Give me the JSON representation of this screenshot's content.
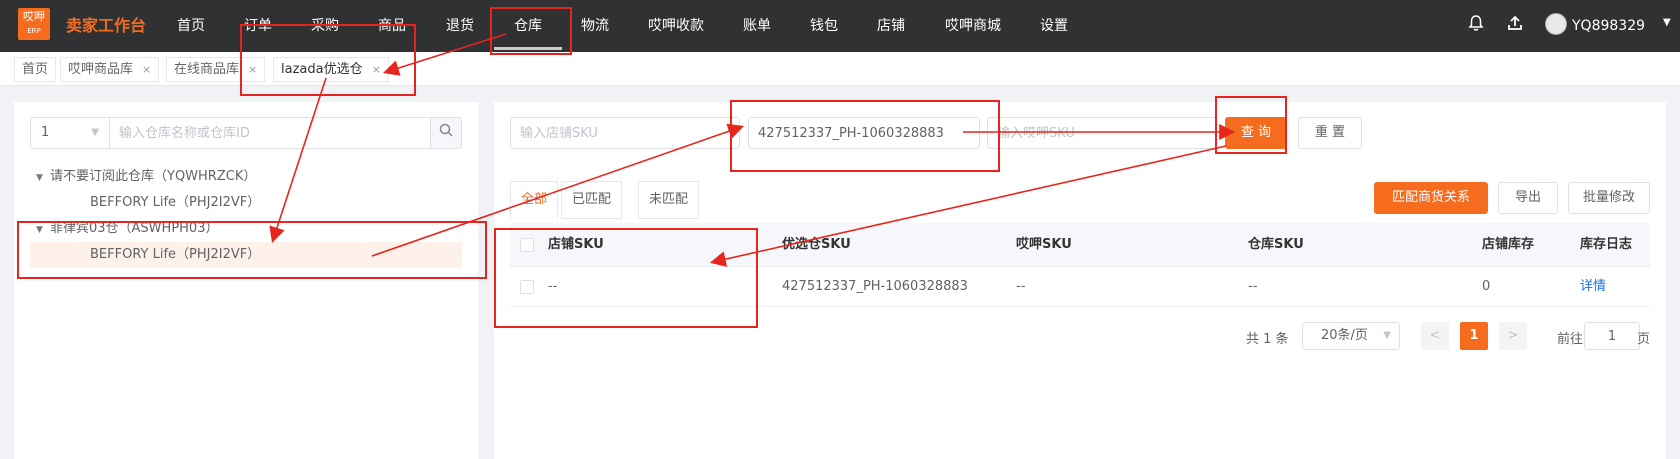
{
  "app": {
    "logo_line1": "哎呷",
    "logo_line2": "ERP",
    "brand": "卖家工作台",
    "accent": "#f56c1f"
  },
  "nav": {
    "items": [
      "首页",
      "订单",
      "采购",
      "商品",
      "退货",
      "仓库",
      "物流",
      "哎呷收款",
      "账单",
      "钱包",
      "店铺",
      "哎呷商城",
      "设置"
    ],
    "active": "仓库"
  },
  "user": {
    "name": "YQ898329",
    "bell_icon": "bell-icon",
    "upload_icon": "upload-icon"
  },
  "tabs": [
    {
      "label": "首页",
      "closable": false
    },
    {
      "label": "哎呷商品库",
      "closable": true,
      "close": "×"
    },
    {
      "label": "在线商品库",
      "closable": true,
      "close": "×"
    },
    {
      "label": "lazada优选仓",
      "closable": true,
      "close": "×",
      "active": true
    }
  ],
  "left": {
    "select_value": "1",
    "search_placeholder": "输入仓库名称或仓库ID",
    "tree": [
      {
        "label": "请不要订阅此仓库（YQWHRZCK）",
        "children": [
          "BEFFORY Life（PHJ2I2VF）"
        ]
      },
      {
        "label": "菲律宾03仓（ASWHPH03）",
        "children": [
          "BEFFORY Life（PHJ2I2VF）"
        ]
      }
    ]
  },
  "filters": {
    "shop_sku_placeholder": "输入店铺SKU",
    "pref_sku_value": "427512337_PH-1060328883",
    "aiya_sku_placeholder": "输入哎呷SKU",
    "query_label": "查 询",
    "reset_label": "重 置"
  },
  "filter_tabs": [
    "全部",
    "已匹配",
    "未匹配"
  ],
  "actions": {
    "match_label": "匹配商货关系",
    "export_label": "导出",
    "batch_label": "批量修改"
  },
  "table": {
    "headers": [
      "店铺SKU",
      "优选仓SKU",
      "哎呷SKU",
      "仓库SKU",
      "店铺库存",
      "库存日志"
    ],
    "rows": [
      [
        "--",
        "427512337_PH-1060328883",
        "--",
        "--",
        "0",
        "详情"
      ]
    ]
  },
  "pagination": {
    "total": "共 1 条",
    "page_size": "20条/页",
    "current": "1",
    "goto_label": "前往",
    "goto_value": "1",
    "page_unit": "页"
  }
}
